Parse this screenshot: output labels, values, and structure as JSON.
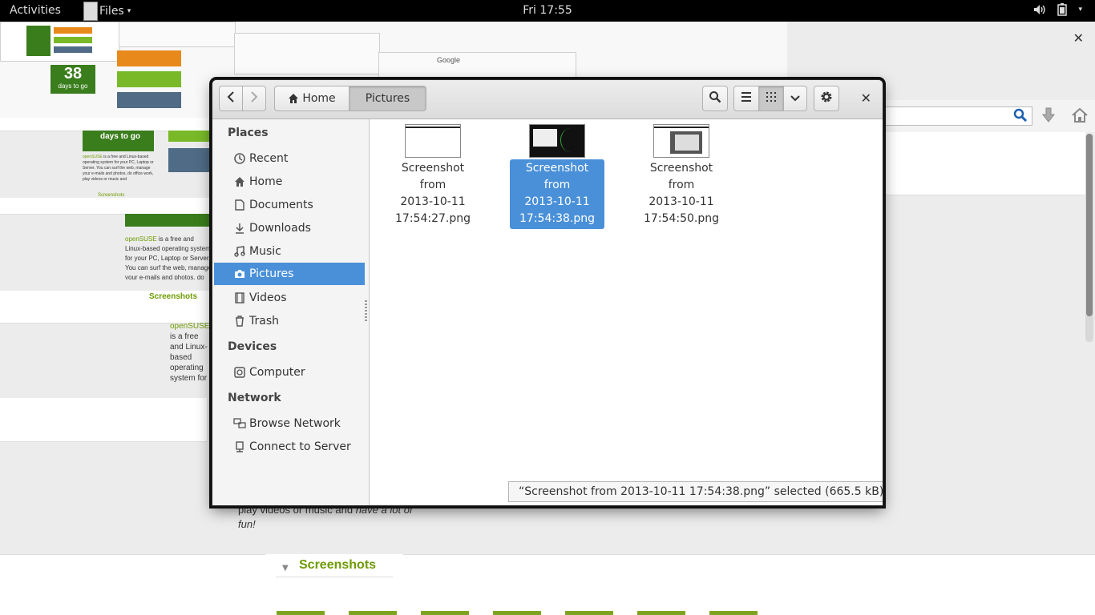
{
  "topbar": {
    "activities": "Activities",
    "app_menu": "Files",
    "clock": "Fri 17:55"
  },
  "background": {
    "search_engine": "Google",
    "days_number": "38",
    "days_label": "days to go",
    "brand": "openSUSE",
    "screenshots_label": "Screenshots",
    "body_text": "is a free and Linux-based operating system for your PC, Laptop or Server. You can surf the web, manage your e-mails and photos, do office work, play videos or music and",
    "body_text_tail": "have a lot of fun!",
    "lower_text_1": "play videos or music and",
    "lower_text_1_italic": "have a lot of",
    "lower_text_2": "fun!"
  },
  "window": {
    "breadcrumbs": [
      "Home",
      "Pictures"
    ],
    "sidebar": {
      "places_heading": "Places",
      "places": [
        {
          "label": "Recent",
          "icon": "clock-icon"
        },
        {
          "label": "Home",
          "icon": "home-icon"
        },
        {
          "label": "Documents",
          "icon": "document-icon"
        },
        {
          "label": "Downloads",
          "icon": "download-icon"
        },
        {
          "label": "Music",
          "icon": "music-icon"
        },
        {
          "label": "Pictures",
          "icon": "camera-icon",
          "selected": true
        },
        {
          "label": "Videos",
          "icon": "film-icon"
        },
        {
          "label": "Trash",
          "icon": "trash-icon"
        }
      ],
      "devices_heading": "Devices",
      "devices": [
        {
          "label": "Computer",
          "icon": "harddisk-icon"
        }
      ],
      "network_heading": "Network",
      "network": [
        {
          "label": "Browse Network",
          "icon": "network-icon"
        },
        {
          "label": "Connect to Server",
          "icon": "server-icon"
        }
      ]
    },
    "files": [
      {
        "line1": "Screenshot from",
        "line2": "2013-10-11",
        "line3": "17:54:27.png",
        "selected": false
      },
      {
        "line1": "Screenshot from",
        "line2": "2013-10-11",
        "line3": "17:54:38.png",
        "selected": true
      },
      {
        "line1": "Screenshot from",
        "line2": "2013-10-11",
        "line3": "17:54:50.png",
        "selected": false
      }
    ],
    "status": "“Screenshot from 2013-10-11 17:54:38.png” selected  (665.5 kB)"
  },
  "colors": {
    "selection": "#4a90d9",
    "topbar": "#000000",
    "opensuse_green": "#6e9b00"
  }
}
